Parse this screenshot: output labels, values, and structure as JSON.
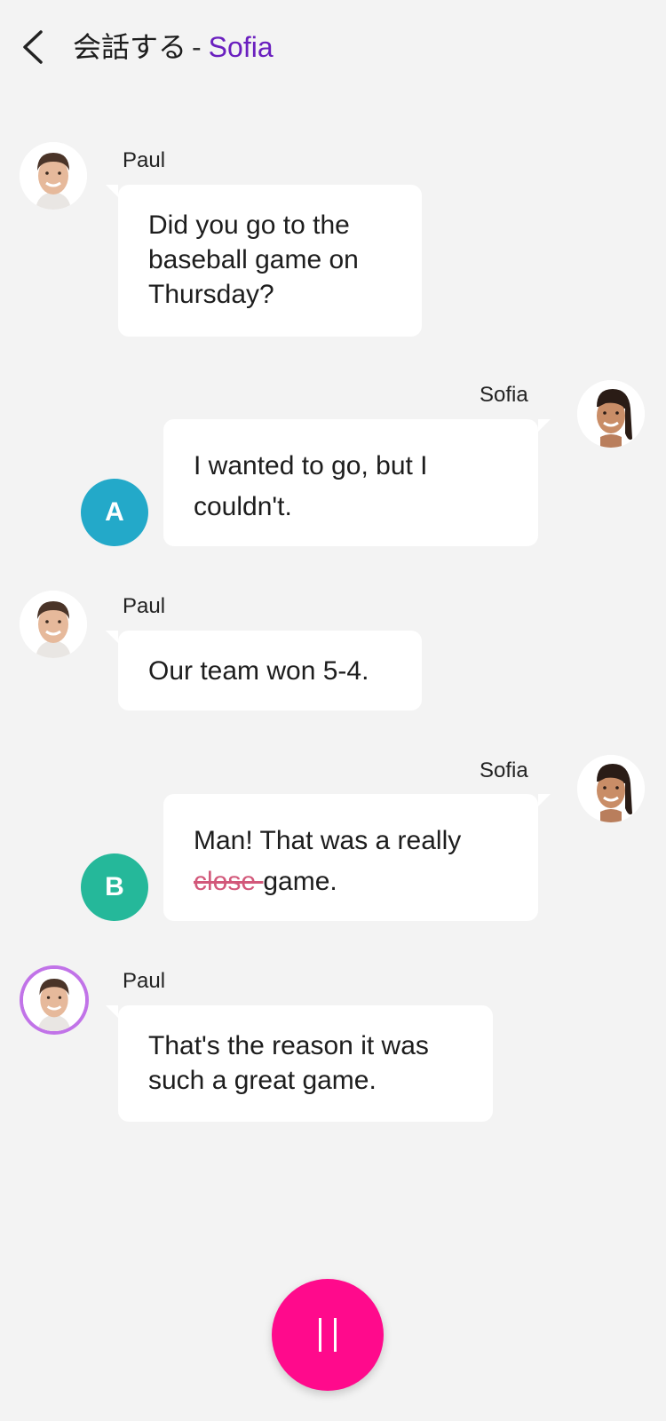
{
  "header": {
    "title": "会話する",
    "separator": "-",
    "partner_name": "Sofia"
  },
  "colors": {
    "background": "#f3f3f3",
    "partner_accent": "#6a1fbf",
    "option_a": "#23a9c9",
    "option_b": "#25b89a",
    "active_ring": "#c173e8",
    "pause_button": "#ff0a8c",
    "strike_text": "#d2587a"
  },
  "messages": [
    {
      "speaker": "Paul",
      "avatar": "paul-avatar",
      "lines": [
        "Did you go to the",
        "baseball game on",
        "Thursday?"
      ]
    },
    {
      "speaker": "Sofia",
      "avatar": "sofia-avatar",
      "option": "A",
      "lines": [
        "I wanted to go, but I",
        "couldn't."
      ]
    },
    {
      "speaker": "Paul",
      "avatar": "paul-avatar",
      "lines": [
        "Our team won 5-4."
      ]
    },
    {
      "speaker": "Sofia",
      "avatar": "sofia-avatar",
      "option": "B",
      "line1": "Man! That was a really",
      "struck": "close ",
      "after": "game."
    },
    {
      "speaker": "Paul",
      "avatar": "paul-avatar",
      "active": true,
      "lines": [
        "That's the reason it was",
        "such a great game."
      ]
    }
  ],
  "controls": {
    "pause_icon": "pause-icon",
    "back_icon": "chevron-left-icon"
  }
}
